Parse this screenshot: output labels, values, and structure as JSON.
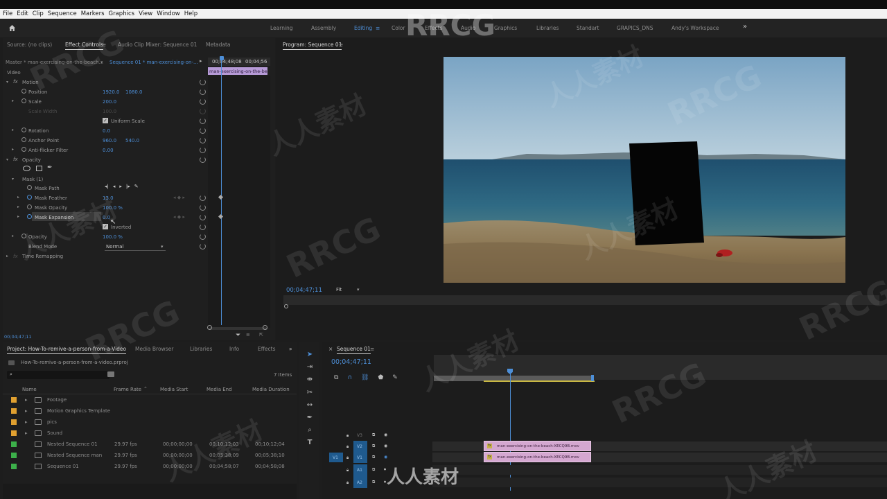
{
  "menubar": {
    "items": [
      "File",
      "Edit",
      "Clip",
      "Sequence",
      "Markers",
      "Graphics",
      "View",
      "Window",
      "Help"
    ]
  },
  "workspaces": {
    "items": [
      "Learning",
      "Assembly",
      "Editing",
      "Color",
      "Effects",
      "Audio",
      "Graphics",
      "Libraries",
      "Standart",
      "GRAPICS_DNS",
      "Andy's Workspace"
    ],
    "active": "Editing",
    "more": "»"
  },
  "source_panel": {
    "tabs": [
      "Source: (no clips)",
      "Effect Controls",
      "Audio Clip Mixer: Sequence 01",
      "Metadata"
    ],
    "active_tab": "Effect Controls",
    "master": "Master * man-exercising-on-the-beach...",
    "sequence": "Sequence 01 * man-exercising-on-...",
    "time_left": "00;04;48;08",
    "time_right": "00;04;56",
    "clip_label": "man-exercising-on-the-be",
    "section_video": "Video",
    "motion": "Motion",
    "position_label": "Position",
    "position_x": "1920.0",
    "position_y": "1080.0",
    "scale_label": "Scale",
    "scale_val": "200.0",
    "scale_width_label": "Scale Width",
    "scale_width_val": "100.0",
    "uniform_scale": "Uniform Scale",
    "rotation_label": "Rotation",
    "rotation_val": "0.0",
    "anchor_label": "Anchor Point",
    "anchor_x": "960.0",
    "anchor_y": "540.0",
    "antiflicker_label": "Anti-flicker Filter",
    "antiflicker_val": "0.00",
    "opacity_section": "Opacity",
    "mask": "Mask (1)",
    "mask_path": "Mask Path",
    "mask_feather_label": "Mask Feather",
    "mask_feather_val": "13.0",
    "mask_opacity_label": "Mask Opacity",
    "mask_opacity_val": "100.0 %",
    "mask_expansion_label": "Mask Expansion",
    "mask_expansion_val": "0.0",
    "inverted": "Inverted",
    "opacity_label": "Opacity",
    "opacity_val": "100.0 %",
    "blend_label": "Blend Mode",
    "blend_val": "Normal",
    "time_remap": "Time Remapping",
    "current_time": "00;04;47;11"
  },
  "program_monitor": {
    "title": "Program: Sequence 01",
    "timecode": "00;04;47;11",
    "fit": "Fit"
  },
  "project_panel": {
    "tabs": [
      "Project: How-To-remive-a-person-from-a-Video",
      "Media Browser",
      "Libraries",
      "Info",
      "Effects"
    ],
    "file": "How-To-remive-a-person-from-a-video.prproj",
    "count": "7 Items",
    "columns": [
      "Name",
      "Frame Rate",
      "Media Start",
      "Media End",
      "Media Duration"
    ],
    "rows": [
      {
        "name": "Footage",
        "type": "folder",
        "color": "#e0a030",
        "rate": "",
        "start": "",
        "end": "",
        "dur": ""
      },
      {
        "name": "Motion Graphics Template",
        "type": "folder",
        "color": "#e0a030",
        "rate": "",
        "start": "",
        "end": "",
        "dur": ""
      },
      {
        "name": "pics",
        "type": "folder",
        "color": "#e0a030",
        "rate": "",
        "start": "",
        "end": "",
        "dur": ""
      },
      {
        "name": "Sound",
        "type": "folder",
        "color": "#e0a030",
        "rate": "",
        "start": "",
        "end": "",
        "dur": ""
      },
      {
        "name": "Nested Sequence 01",
        "type": "seq",
        "color": "#3cb04a",
        "rate": "29.97 fps",
        "start": "00;00;00;00",
        "end": "00;10;12;03",
        "dur": "00;10;12;04"
      },
      {
        "name": "Nested Sequence man",
        "type": "seq",
        "color": "#3cb04a",
        "rate": "29.97 fps",
        "start": "00;00;00;00",
        "end": "00;05;38;09",
        "dur": "00;05;38;10"
      },
      {
        "name": "Sequence 01",
        "type": "seq",
        "color": "#3cb04a",
        "rate": "29.97 fps",
        "start": "00;00;00;00",
        "end": "00;04;58;07",
        "dur": "00;04;58;08"
      }
    ]
  },
  "timeline": {
    "title": "Sequence 01",
    "timecode": "00;04;47;11",
    "tracks": [
      "V3",
      "V2",
      "V1",
      "A1",
      "A2"
    ],
    "clip_top": "man-exercising-on-the-beach-XECQ9B.mov",
    "clip_bottom": "man-exercising-on-the-beach-XECQ9B.mov"
  },
  "watermark": {
    "text": "RRCG",
    "text2": "人人素材"
  }
}
